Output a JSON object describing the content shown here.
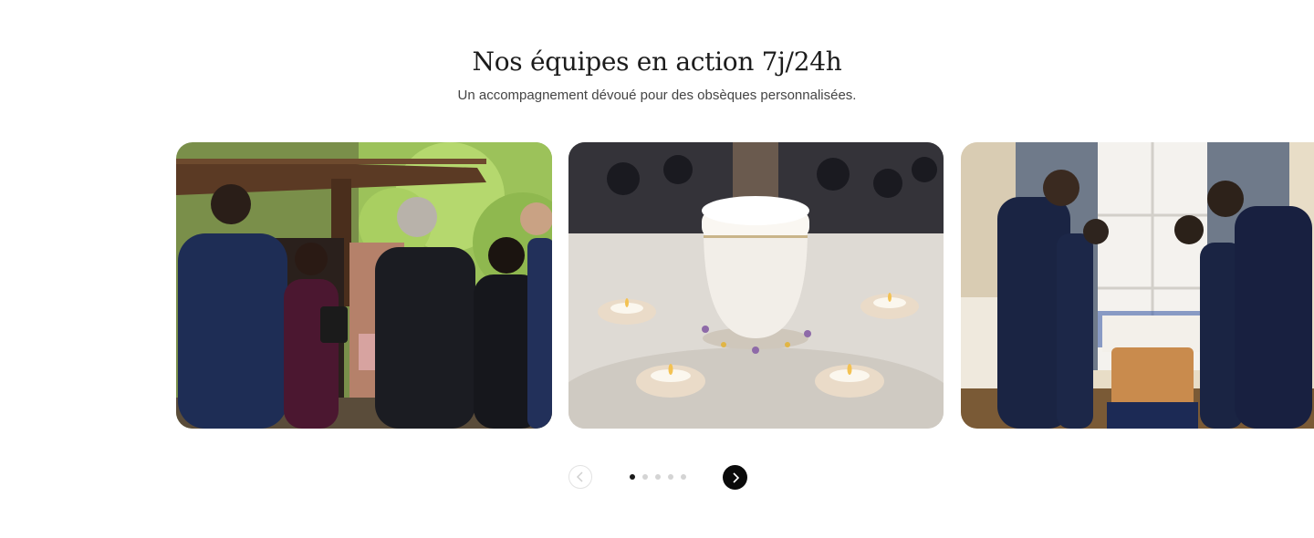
{
  "section": {
    "title": "Nos équipes en action 7j/24h",
    "subtitle": "Un accompagnement dévoué pour des obsèques personnalisées."
  },
  "carousel": {
    "slides": [
      {
        "image": "cemetery-ceremony-photo"
      },
      {
        "image": "urn-with-candles-photo"
      },
      {
        "image": "staff-bowing-at-coffin-photo"
      }
    ],
    "pagination": {
      "total": 5,
      "active_index": 0
    },
    "prev_icon": "chevron-left-icon",
    "next_icon": "chevron-right-icon",
    "colors": {
      "next_button": "#0a0a0a",
      "dot_active": "#1a1a1a",
      "dot_inactive": "#d4d4d4"
    }
  }
}
